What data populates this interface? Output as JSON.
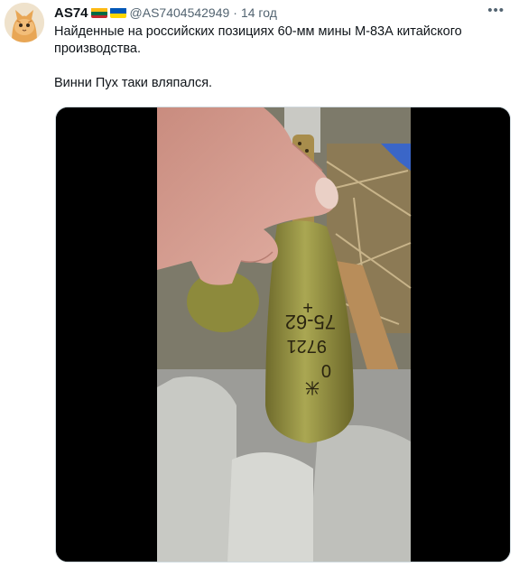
{
  "tweet": {
    "display_name": "AS74",
    "flags": [
      "lithuania-flag",
      "ukraine-flag"
    ],
    "handle": "@AS7404542949",
    "separator": "·",
    "time": "14 год",
    "more_icon": "more-horizontal-icon",
    "text_line1": "Найденные на российских позициях 60-мм мины М-83А китайского производства.",
    "text_line2": "Винни Пух таки вляпался.",
    "media": {
      "type": "video",
      "shell_markings": [
        "+",
        "75-62",
        "9721",
        "0",
        "米"
      ]
    }
  },
  "colors": {
    "text_primary": "#0f1419",
    "text_secondary": "#536471",
    "shell_olive": "#9c9a46",
    "lithuania": [
      "#fdb913",
      "#006a44",
      "#c1272d"
    ],
    "ukraine": [
      "#0057b7",
      "#ffd700"
    ]
  }
}
